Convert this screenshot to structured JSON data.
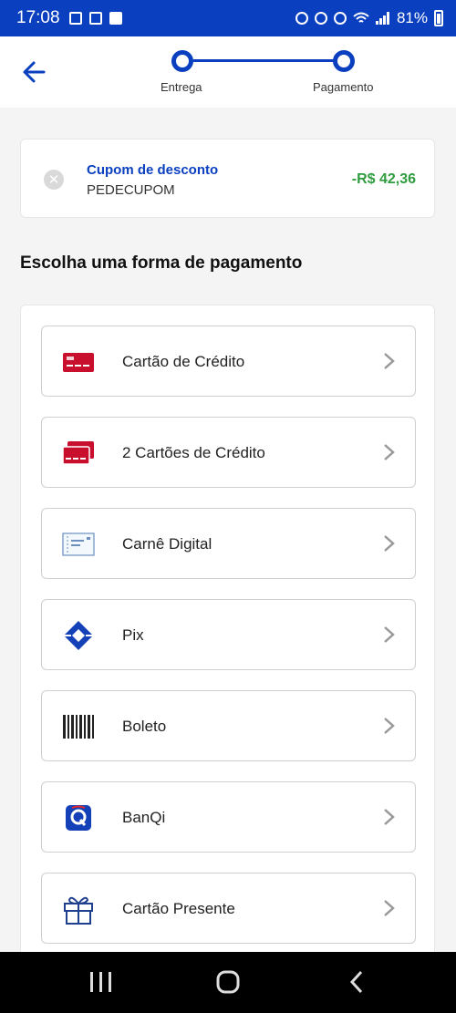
{
  "status_bar": {
    "time": "17:08",
    "battery": "81%"
  },
  "stepper": {
    "steps": [
      {
        "label": "Entrega"
      },
      {
        "label": "Pagamento"
      }
    ]
  },
  "coupon": {
    "title": "Cupom de desconto",
    "code": "PEDECUPOM",
    "discount": "-R$ 42,36"
  },
  "section_title": "Escolha uma forma de pagamento",
  "payment_methods": [
    {
      "label": "Cartão de Crédito",
      "icon": "credit-card-icon"
    },
    {
      "label": "2 Cartões de Crédito",
      "icon": "two-cards-icon"
    },
    {
      "label": "Carnê Digital",
      "icon": "carne-digital-icon"
    },
    {
      "label": "Pix",
      "icon": "pix-icon"
    },
    {
      "label": "Boleto",
      "icon": "barcode-icon"
    },
    {
      "label": "BanQi",
      "icon": "banqi-icon"
    },
    {
      "label": "Cartão Presente",
      "icon": "gift-icon"
    }
  ],
  "colors": {
    "brand_blue": "#0a3fbf",
    "discount_green": "#2e9c3f",
    "card_red": "#c8102e"
  }
}
